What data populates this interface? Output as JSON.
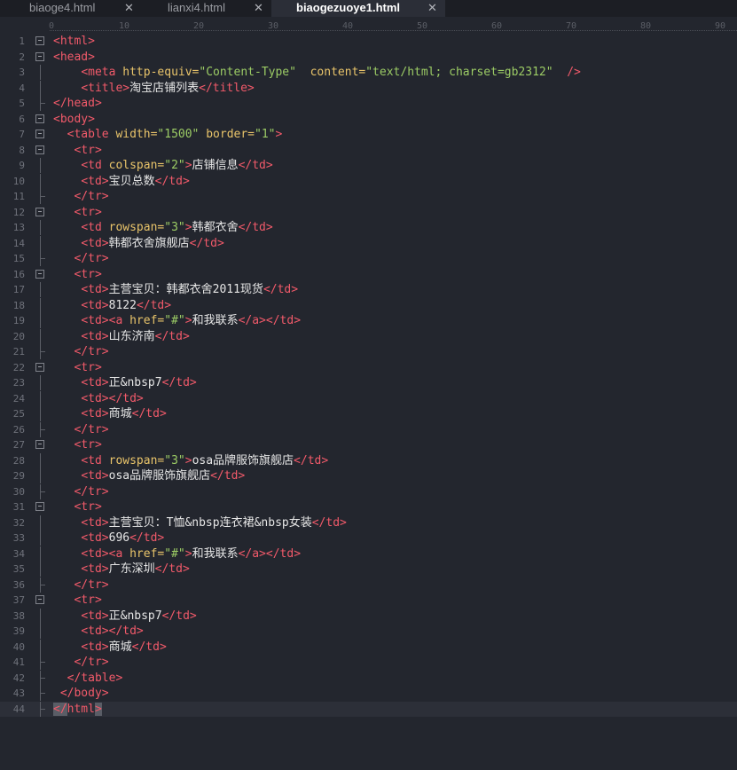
{
  "tabs": [
    {
      "label": "biaoge4.html",
      "active": false
    },
    {
      "label": "lianxi4.html",
      "active": false
    },
    {
      "label": "biaogezuoye1.html",
      "active": true
    }
  ],
  "close_glyph": "✕",
  "ruler": {
    "ticks": [
      "0",
      "10",
      "20",
      "30",
      "40",
      "50",
      "60",
      "70",
      "80",
      "90"
    ]
  },
  "colors": {
    "tag": "#f25a6a",
    "attr": "#e9c46a",
    "string": "#9ccc65",
    "text": "#e6e6e6",
    "background": "#23262e"
  },
  "editor": {
    "current_line": 44,
    "lines": [
      {
        "n": "1",
        "fold": true,
        "tokens": [
          [
            "t",
            "<html>"
          ]
        ]
      },
      {
        "n": "2",
        "fold": true,
        "tokens": [
          [
            "t",
            "<head>"
          ]
        ]
      },
      {
        "n": "3",
        "tokens": [
          [
            "x",
            "    "
          ],
          [
            "t",
            "<meta "
          ],
          [
            "a",
            "http-equiv="
          ],
          [
            "s",
            "\"Content-Type\""
          ],
          [
            "x",
            "  "
          ],
          [
            "a",
            "content="
          ],
          [
            "s",
            "\"text/html; charset=gb2312\""
          ],
          [
            "x",
            "  "
          ],
          [
            "t",
            "/>"
          ]
        ]
      },
      {
        "n": "4",
        "tokens": [
          [
            "x",
            "    "
          ],
          [
            "t",
            "<title>"
          ],
          [
            "x",
            "淘宝店铺列表"
          ],
          [
            "t",
            "</title>"
          ]
        ]
      },
      {
        "n": "5",
        "end": true,
        "tokens": [
          [
            "t",
            "</head>"
          ]
        ]
      },
      {
        "n": "6",
        "fold": true,
        "tokens": [
          [
            "t",
            "<body>"
          ]
        ]
      },
      {
        "n": "7",
        "fold": true,
        "tokens": [
          [
            "x",
            "  "
          ],
          [
            "t",
            "<table "
          ],
          [
            "a",
            "width="
          ],
          [
            "s",
            "\"1500\""
          ],
          [
            "x",
            " "
          ],
          [
            "a",
            "border="
          ],
          [
            "s",
            "\"1\""
          ],
          [
            "t",
            ">"
          ]
        ]
      },
      {
        "n": "8",
        "fold": true,
        "tokens": [
          [
            "x",
            "   "
          ],
          [
            "t",
            "<tr>"
          ]
        ]
      },
      {
        "n": "9",
        "tokens": [
          [
            "x",
            "    "
          ],
          [
            "t",
            "<td "
          ],
          [
            "a",
            "colspan="
          ],
          [
            "s",
            "\"2\""
          ],
          [
            "t",
            ">"
          ],
          [
            "x",
            "店铺信息"
          ],
          [
            "t",
            "</td>"
          ]
        ]
      },
      {
        "n": "10",
        "tokens": [
          [
            "x",
            "    "
          ],
          [
            "t",
            "<td>"
          ],
          [
            "x",
            "宝贝总数"
          ],
          [
            "t",
            "</td>"
          ]
        ]
      },
      {
        "n": "11",
        "end": true,
        "tokens": [
          [
            "x",
            "   "
          ],
          [
            "t",
            "</tr>"
          ]
        ]
      },
      {
        "n": "12",
        "fold": true,
        "tokens": [
          [
            "x",
            "   "
          ],
          [
            "t",
            "<tr>"
          ]
        ]
      },
      {
        "n": "13",
        "tokens": [
          [
            "x",
            "    "
          ],
          [
            "t",
            "<td "
          ],
          [
            "a",
            "rowspan="
          ],
          [
            "s",
            "\"3\""
          ],
          [
            "t",
            ">"
          ],
          [
            "x",
            "韩都衣舍"
          ],
          [
            "t",
            "</td>"
          ]
        ]
      },
      {
        "n": "14",
        "tokens": [
          [
            "x",
            "    "
          ],
          [
            "t",
            "<td>"
          ],
          [
            "x",
            "韩都衣舍旗舰店"
          ],
          [
            "t",
            "</td>"
          ]
        ]
      },
      {
        "n": "15",
        "end": true,
        "tokens": [
          [
            "x",
            "   "
          ],
          [
            "t",
            "</tr>"
          ]
        ]
      },
      {
        "n": "16",
        "fold": true,
        "tokens": [
          [
            "x",
            "   "
          ],
          [
            "t",
            "<tr>"
          ]
        ]
      },
      {
        "n": "17",
        "tokens": [
          [
            "x",
            "    "
          ],
          [
            "t",
            "<td>"
          ],
          [
            "x",
            "主营宝贝：韩都衣舍2011现货"
          ],
          [
            "t",
            "</td>"
          ]
        ]
      },
      {
        "n": "18",
        "tokens": [
          [
            "x",
            "    "
          ],
          [
            "t",
            "<td>"
          ],
          [
            "x",
            "8122"
          ],
          [
            "t",
            "</td>"
          ]
        ]
      },
      {
        "n": "19",
        "tokens": [
          [
            "x",
            "    "
          ],
          [
            "t",
            "<td><a "
          ],
          [
            "a",
            "href="
          ],
          [
            "s",
            "\"#\""
          ],
          [
            "t",
            ">"
          ],
          [
            "x",
            "和我联系"
          ],
          [
            "t",
            "</a></td>"
          ]
        ]
      },
      {
        "n": "20",
        "tokens": [
          [
            "x",
            "    "
          ],
          [
            "t",
            "<td>"
          ],
          [
            "x",
            "山东济南"
          ],
          [
            "t",
            "</td>"
          ]
        ]
      },
      {
        "n": "21",
        "end": true,
        "tokens": [
          [
            "x",
            "   "
          ],
          [
            "t",
            "</tr>"
          ]
        ]
      },
      {
        "n": "22",
        "fold": true,
        "tokens": [
          [
            "x",
            "   "
          ],
          [
            "t",
            "<tr>"
          ]
        ]
      },
      {
        "n": "23",
        "tokens": [
          [
            "x",
            "    "
          ],
          [
            "t",
            "<td>"
          ],
          [
            "x",
            "正&nbsp7"
          ],
          [
            "t",
            "</td>"
          ]
        ]
      },
      {
        "n": "24",
        "tokens": [
          [
            "x",
            "    "
          ],
          [
            "t",
            "<td></td>"
          ]
        ]
      },
      {
        "n": "25",
        "tokens": [
          [
            "x",
            "    "
          ],
          [
            "t",
            "<td>"
          ],
          [
            "x",
            "商城"
          ],
          [
            "t",
            "</td>"
          ]
        ]
      },
      {
        "n": "26",
        "end": true,
        "tokens": [
          [
            "x",
            "   "
          ],
          [
            "t",
            "</tr>"
          ]
        ]
      },
      {
        "n": "27",
        "fold": true,
        "tokens": [
          [
            "x",
            "   "
          ],
          [
            "t",
            "<tr>"
          ]
        ]
      },
      {
        "n": "28",
        "tokens": [
          [
            "x",
            "    "
          ],
          [
            "t",
            "<td "
          ],
          [
            "a",
            "rowspan="
          ],
          [
            "s",
            "\"3\""
          ],
          [
            "t",
            ">"
          ],
          [
            "x",
            "osa品牌服饰旗舰店"
          ],
          [
            "t",
            "</td>"
          ]
        ]
      },
      {
        "n": "29",
        "tokens": [
          [
            "x",
            "    "
          ],
          [
            "t",
            "<td>"
          ],
          [
            "x",
            "osa品牌服饰旗舰店"
          ],
          [
            "t",
            "</td>"
          ]
        ]
      },
      {
        "n": "30",
        "end": true,
        "tokens": [
          [
            "x",
            "   "
          ],
          [
            "t",
            "</tr>"
          ]
        ]
      },
      {
        "n": "31",
        "fold": true,
        "tokens": [
          [
            "x",
            "   "
          ],
          [
            "t",
            "<tr>"
          ]
        ]
      },
      {
        "n": "32",
        "tokens": [
          [
            "x",
            "    "
          ],
          [
            "t",
            "<td>"
          ],
          [
            "x",
            "主营宝贝：T恤&nbsp连衣裙&nbsp女装"
          ],
          [
            "t",
            "</td>"
          ]
        ]
      },
      {
        "n": "33",
        "tokens": [
          [
            "x",
            "    "
          ],
          [
            "t",
            "<td>"
          ],
          [
            "x",
            "696"
          ],
          [
            "t",
            "</td>"
          ]
        ]
      },
      {
        "n": "34",
        "tokens": [
          [
            "x",
            "    "
          ],
          [
            "t",
            "<td><a "
          ],
          [
            "a",
            "href="
          ],
          [
            "s",
            "\"#\""
          ],
          [
            "t",
            ">"
          ],
          [
            "x",
            "和我联系"
          ],
          [
            "t",
            "</a></td>"
          ]
        ]
      },
      {
        "n": "35",
        "tokens": [
          [
            "x",
            "    "
          ],
          [
            "t",
            "<td>"
          ],
          [
            "x",
            "广东深圳"
          ],
          [
            "t",
            "</td>"
          ]
        ]
      },
      {
        "n": "36",
        "end": true,
        "tokens": [
          [
            "x",
            "   "
          ],
          [
            "t",
            "</tr>"
          ]
        ]
      },
      {
        "n": "37",
        "fold": true,
        "tokens": [
          [
            "x",
            "   "
          ],
          [
            "t",
            "<tr>"
          ]
        ]
      },
      {
        "n": "38",
        "tokens": [
          [
            "x",
            "    "
          ],
          [
            "t",
            "<td>"
          ],
          [
            "x",
            "正&nbsp7"
          ],
          [
            "t",
            "</td>"
          ]
        ]
      },
      {
        "n": "39",
        "tokens": [
          [
            "x",
            "    "
          ],
          [
            "t",
            "<td></td>"
          ]
        ]
      },
      {
        "n": "40",
        "tokens": [
          [
            "x",
            "    "
          ],
          [
            "t",
            "<td>"
          ],
          [
            "x",
            "商城"
          ],
          [
            "t",
            "</td>"
          ]
        ]
      },
      {
        "n": "41",
        "end": true,
        "tokens": [
          [
            "x",
            "   "
          ],
          [
            "t",
            "</tr>"
          ]
        ]
      },
      {
        "n": "42",
        "end": true,
        "tokens": [
          [
            "x",
            "  "
          ],
          [
            "t",
            "</table>"
          ]
        ]
      },
      {
        "n": "43",
        "end": true,
        "tokens": [
          [
            "x",
            " "
          ],
          [
            "t",
            "</body>"
          ]
        ]
      },
      {
        "n": "44",
        "end": true,
        "tokens": [
          [
            "sel",
            "</"
          ],
          [
            "t",
            "html"
          ],
          [
            "sel",
            ">"
          ]
        ]
      }
    ]
  }
}
